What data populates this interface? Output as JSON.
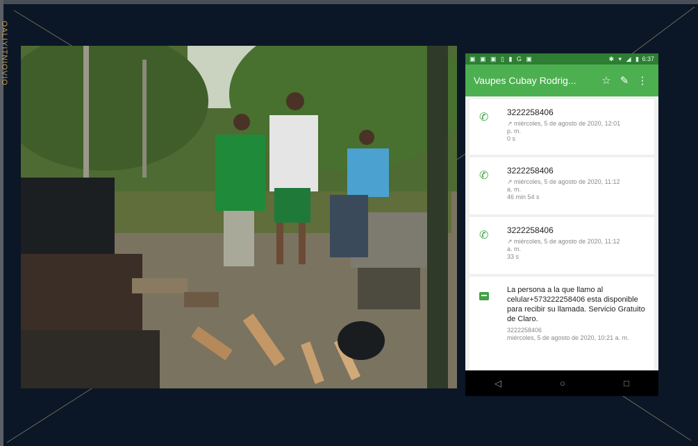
{
  "slide": {
    "vertical_text": "OALIYITNIOVIO"
  },
  "photo": {
    "icon": "outdoor-photo"
  },
  "phone": {
    "status_bar": {
      "left_icons": "▣ ▣ ▣ ▯ ▮ G ▣",
      "right_icons": "✱ ▾ ◢ ▮",
      "time": "6:37"
    },
    "app_bar": {
      "title": "Vaupes Cubay Rodrig...",
      "star_icon": "☆",
      "edit_icon": "✎",
      "menu_icon": "⋮"
    },
    "calls": [
      {
        "number": "3222258406",
        "date": "↗ miércoles, 5 de agosto de 2020, 12:01",
        "ampm": "p. m.",
        "duration": "0 s"
      },
      {
        "number": "3222258406",
        "date": "↗ miércoles, 5 de agosto de 2020, 11:12",
        "ampm": "a. m.",
        "duration": "46 min 54 s"
      },
      {
        "number": "3222258406",
        "date": "↗ miércoles, 5 de agosto de 2020, 11:12",
        "ampm": "a. m.",
        "duration": "33 s"
      }
    ],
    "message": {
      "text": "La persona a la que llamo al celular+573222258406 esta disponible para recibir su llamada. Servicio Gratuito de Claro.",
      "number": "3222258406",
      "date": "miércoles, 5 de agosto de 2020, 10:21 a. m."
    },
    "nav": {
      "back": "◁",
      "home": "○",
      "recents": "□"
    }
  }
}
